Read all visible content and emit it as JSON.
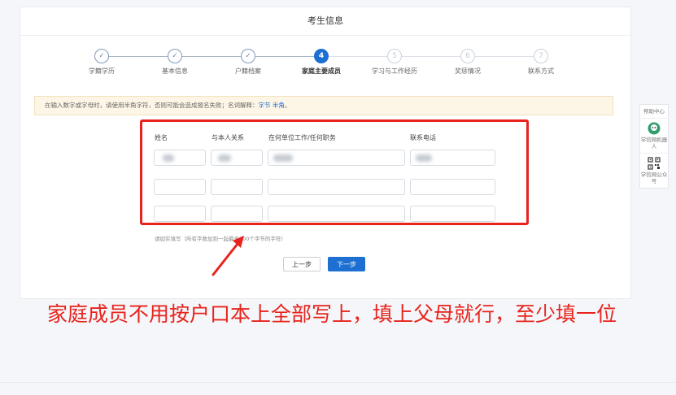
{
  "page": {
    "title": "考生信息"
  },
  "steps": [
    {
      "num": "✓",
      "label": "学籍学历",
      "state": "done"
    },
    {
      "num": "✓",
      "label": "基本信息",
      "state": "done"
    },
    {
      "num": "✓",
      "label": "户籍档案",
      "state": "done"
    },
    {
      "num": "4",
      "label": "家庭主要成员",
      "state": "active"
    },
    {
      "num": "5",
      "label": "学习与工作经历",
      "state": "pending"
    },
    {
      "num": "6",
      "label": "奖惩情况",
      "state": "pending"
    },
    {
      "num": "7",
      "label": "联系方式",
      "state": "pending"
    }
  ],
  "notice": {
    "text": "在输入数字或字母时，请使用半角字符，否则可能会造成报名失败；名词解释：",
    "link1": "字节",
    "link2": "半角",
    "end": "。"
  },
  "table": {
    "headers": [
      "姓名",
      "与本人关系",
      "在何单位工作/任何职务",
      "联系电话"
    ]
  },
  "hint": "请如实填写（所有字数加到一起最多200个字节的字符）",
  "buttons": {
    "prev": "上一步",
    "next": "下一步"
  },
  "annotation": "家庭成员不用按户口本上全部写上，填上父母就行，至少填一位",
  "side": {
    "help": "帮助中心",
    "robot": "学信网机器人",
    "wechat": "学信网公众号"
  },
  "colors": {
    "accent": "#1d6fd1",
    "annotation_red": "#e8231c",
    "notice_bg": "#fdf5e6"
  }
}
